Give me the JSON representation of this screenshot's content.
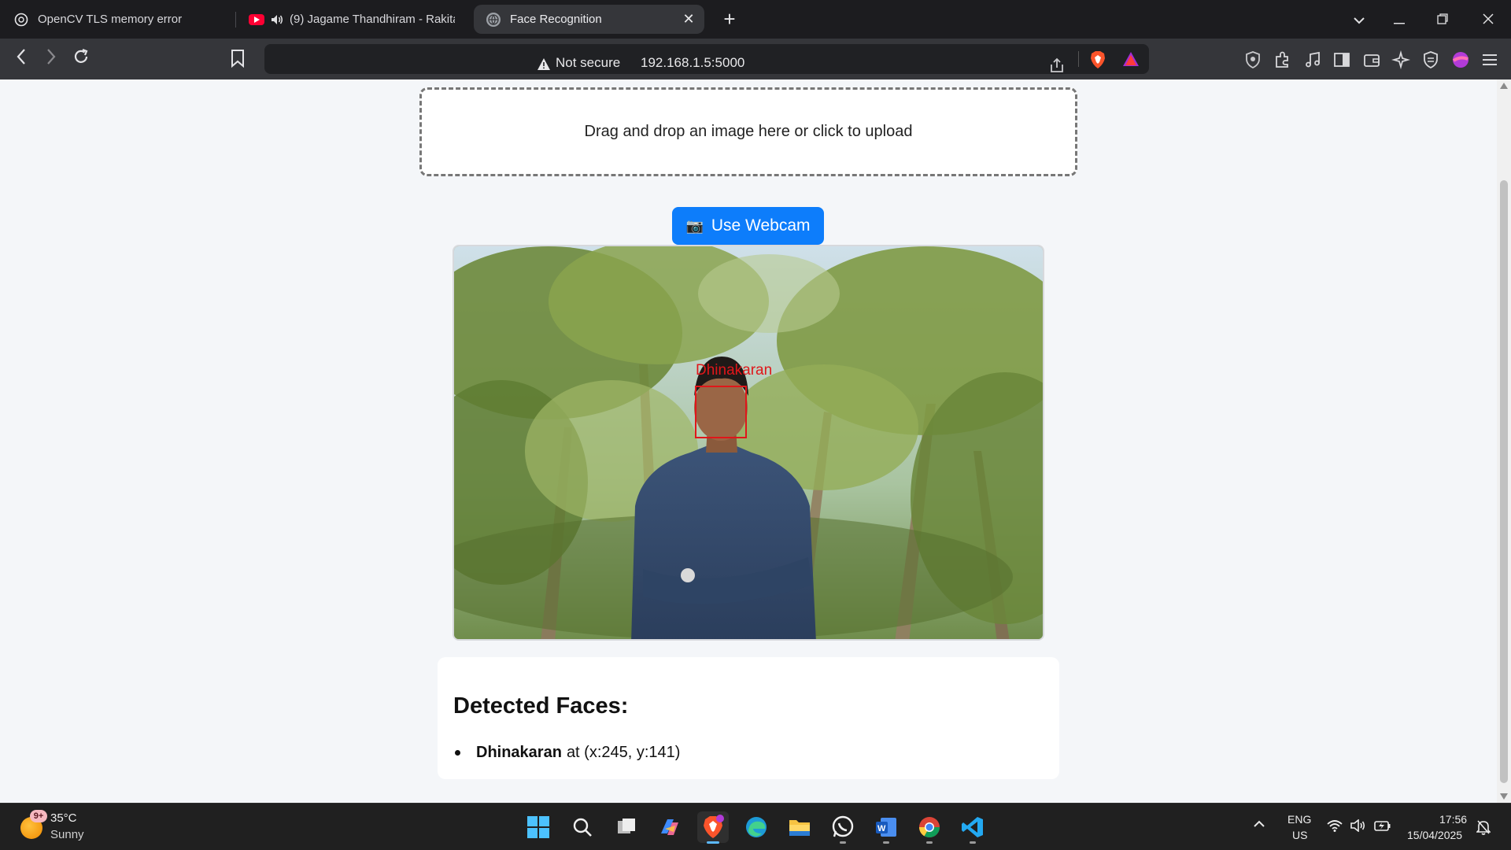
{
  "browser": {
    "tabs": [
      {
        "title": "OpenCV TLS memory error",
        "icon": "chatgpt-icon"
      },
      {
        "title": "(9) Jagame Thandhiram - Rakita",
        "icon": "youtube-icon",
        "audio": true
      },
      {
        "title": "Face Recognition",
        "icon": "globe-icon",
        "active": true
      }
    ],
    "security_label": "Not secure",
    "url": "192.168.1.5:5000"
  },
  "page": {
    "dropzone_text": "Drag and drop an image here or click to upload",
    "webcam_button": {
      "icon": "📷",
      "label": "Use Webcam"
    },
    "detection_overlay_label": "Dhinakaran",
    "results": {
      "heading": "Detected Faces:",
      "faces": [
        {
          "name": "Dhinakaran",
          "position_text": "at (x:245, y:141)"
        }
      ]
    }
  },
  "taskbar": {
    "weather": {
      "badge": "9+",
      "temp": "35°C",
      "condition": "Sunny"
    },
    "apps": [
      "windows-start",
      "search",
      "task-view",
      "copilot",
      "brave",
      "edge",
      "file-explorer",
      "whatsapp",
      "word",
      "chrome",
      "vscode"
    ],
    "language": {
      "line1": "ENG",
      "line2": "US"
    },
    "time": "17:56",
    "date": "15/04/2025"
  },
  "colors": {
    "accent_button": "#0d7dfb",
    "detection_box": "#e0161a",
    "page_background": "#f4f6f9"
  }
}
